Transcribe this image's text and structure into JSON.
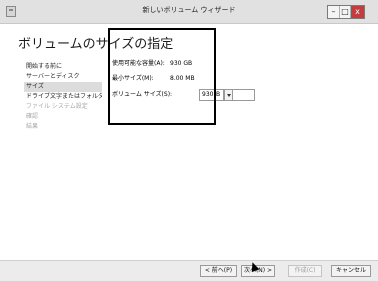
{
  "window": {
    "title": "新しいボリューム ウィザード",
    "minimize": "–",
    "maximize": "□",
    "close": "x"
  },
  "page_title": "ボリュームのサイズの指定",
  "nav": {
    "items": [
      {
        "label": "開始する前に",
        "state": "normal"
      },
      {
        "label": "サーバーとディスク",
        "state": "normal"
      },
      {
        "label": "サイズ",
        "state": "active"
      },
      {
        "label": "ドライブ文字またはフォルダー",
        "state": "normal"
      },
      {
        "label": "ファイル システム設定",
        "state": "disabled"
      },
      {
        "label": "確認",
        "state": "disabled"
      },
      {
        "label": "結果",
        "state": "disabled"
      }
    ]
  },
  "form": {
    "available_label": "使用可能な容量(A):",
    "available_value": "930 GB",
    "min_label": "最小サイズ(M):",
    "min_value": "8.00 MB",
    "size_label": "ボリューム サイズ(S):",
    "size_value": "930",
    "unit_value": "B"
  },
  "buttons": {
    "prev": "< 前へ(P)",
    "next": "次へ(N) >",
    "create": "作成(C)",
    "cancel": "キャンセル"
  }
}
